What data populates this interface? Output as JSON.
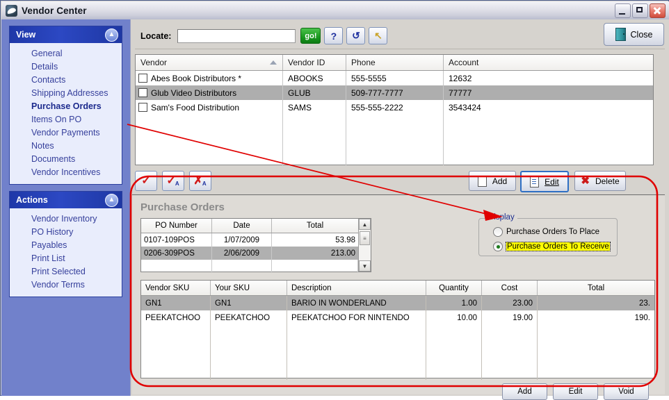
{
  "window": {
    "title": "Vendor Center",
    "icon": "vendor-center-logo",
    "controls": {
      "minimize": "minimize-icon",
      "maximize": "maximize-icon",
      "close": "close-icon"
    }
  },
  "sidebar": {
    "view_panel": {
      "title": "View",
      "collapse_icon": "chevron-up-icon",
      "items": [
        {
          "label": "General",
          "active": false
        },
        {
          "label": "Details",
          "active": false
        },
        {
          "label": "Contacts",
          "active": false
        },
        {
          "label": "Shipping Addresses",
          "active": false
        },
        {
          "label": "Purchase Orders",
          "active": true
        },
        {
          "label": "Items On PO",
          "active": false
        },
        {
          "label": "Vendor Payments",
          "active": false
        },
        {
          "label": "Notes",
          "active": false
        },
        {
          "label": "Documents",
          "active": false
        },
        {
          "label": "Vendor Incentives",
          "active": false
        }
      ]
    },
    "actions_panel": {
      "title": "Actions",
      "collapse_icon": "chevron-up-icon",
      "items": [
        {
          "label": "Vendor Inventory"
        },
        {
          "label": "PO History"
        },
        {
          "label": "Payables"
        },
        {
          "label": "Print List"
        },
        {
          "label": "Print Selected"
        },
        {
          "label": "Vendor Terms"
        }
      ]
    }
  },
  "toolbar": {
    "locate_label": "Locate:",
    "locate_value": "",
    "locate_placeholder": "",
    "go_label": "go!",
    "help_label": "?",
    "refresh_label": "↺",
    "jump_label": "↖",
    "close_label": "Close"
  },
  "vendor_grid": {
    "columns": [
      "Vendor",
      "Vendor ID",
      "Phone",
      "Account"
    ],
    "sort_column": "Vendor",
    "sort_direction": "asc",
    "rows": [
      {
        "checked": false,
        "vendor": "Abes Book Distributors *",
        "vendor_id": "ABOOKS",
        "phone": "555-5555",
        "account": "12632",
        "selected": false
      },
      {
        "checked": false,
        "vendor": "Glub Video Distributors",
        "vendor_id": "GLUB",
        "phone": "509-777-7777",
        "account": "77777",
        "selected": true
      },
      {
        "checked": false,
        "vendor": "Sam's Food Distribution",
        "vendor_id": "SAMS",
        "phone": "555-555-2222",
        "account": "3543424",
        "selected": false
      }
    ]
  },
  "grid_actions": {
    "check_label": "✓",
    "check_all_label": "✓",
    "check_all_sub": "A",
    "uncheck_all_label": "✗",
    "uncheck_all_sub": "A",
    "add_label": "Add",
    "edit_label": "Edit",
    "delete_label": "Delete"
  },
  "purchase_orders": {
    "title": "Purchase Orders",
    "columns": [
      "PO Number",
      "Date",
      "Total"
    ],
    "rows": [
      {
        "po_number": "0107-109POS",
        "date": "1/07/2009",
        "total": "53.98",
        "selected": false
      },
      {
        "po_number": "0206-309POS",
        "date": "2/06/2009",
        "total": "213.00",
        "selected": true
      }
    ],
    "scroll_up_icon": "chevron-up-icon",
    "scroll_down_icon": "chevron-down-icon"
  },
  "display_group": {
    "legend": "Display",
    "options": [
      {
        "label": "Purchase Orders To Place",
        "selected": false,
        "highlighted": false
      },
      {
        "label": "Purchase Orders To Receive",
        "selected": true,
        "highlighted": true
      }
    ]
  },
  "items_grid": {
    "columns": [
      "Vendor SKU",
      "Your SKU",
      "Description",
      "Quantity",
      "Cost",
      "Total"
    ],
    "rows": [
      {
        "vendor_sku": "GN1",
        "your_sku": "GN1",
        "description": "BARIO IN WONDERLAND",
        "quantity": "1.00",
        "cost": "23.00",
        "total": "23.",
        "selected": true
      },
      {
        "vendor_sku": "PEEKATCHOO",
        "your_sku": "PEEKATCHOO",
        "description": "PEEKATCHOO FOR NINTENDO",
        "quantity": "10.00",
        "cost": "19.00",
        "total": "190.",
        "selected": false
      }
    ]
  },
  "bottom_buttons": {
    "add_label": "Add",
    "edit_label": "Edit",
    "void_label": "Void"
  },
  "annotations": {
    "highlight_color": "#ff0000",
    "arrow": "red-arrow-pointing-to-receive-radio",
    "ellipse": "red-outline-around-purchase-orders-panel"
  }
}
